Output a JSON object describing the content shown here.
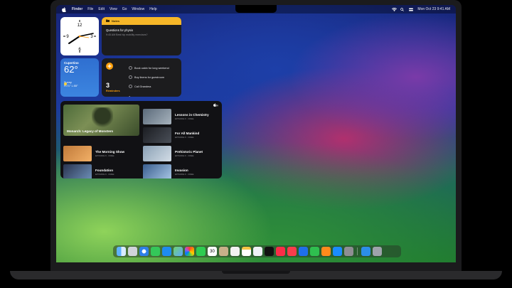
{
  "menubar": {
    "apple": "",
    "items": [
      "Finder",
      "File",
      "Edit",
      "View",
      "Go",
      "Window",
      "Help"
    ],
    "datetime": "Mon Oct 23  9:41 AM"
  },
  "notes": {
    "header": "Notes",
    "title": "Questions for physio",
    "subtitle": "9:45 AM  Best hip mobility exercises?"
  },
  "weather": {
    "city": "Cupertino",
    "temp": "62°",
    "condition": "Sunny",
    "highlow": "H:71° L:55°"
  },
  "reminders": {
    "count": "3",
    "label": "Reminders",
    "items": [
      "Book cabin for long weekend",
      "Buy linens for guestroom",
      "Call Grandma"
    ]
  },
  "tv": {
    "logo": "tv",
    "feature_title": "Monarch: Legacy of Monsters",
    "shows": [
      {
        "title": "Lessons in Chemistry",
        "sub": "EPISODE 6 · FREE"
      },
      {
        "title": "For All Mankind",
        "sub": "EPISODE 6 · FREE"
      },
      {
        "title": "The Morning Show",
        "sub": "EPISODE 6 · FREE"
      },
      {
        "title": "Prehistoric Planet",
        "sub": "EPISODE 6 · FREE"
      },
      {
        "title": "Foundation",
        "sub": "EPISODE 6 · FREE"
      },
      {
        "title": "Invasion",
        "sub": "EPISODE 6 · FREE"
      }
    ]
  },
  "dock": {
    "calendar_day": "30",
    "apps": [
      "finder",
      "launchpad",
      "safari",
      "messages",
      "mail",
      "maps",
      "photos",
      "facetime",
      "calendar",
      "contacts",
      "reminders",
      "notes",
      "freeform",
      "tv",
      "music",
      "news",
      "keynote",
      "numbers",
      "pages",
      "app-store",
      "settings",
      "downloads",
      "trash"
    ]
  }
}
